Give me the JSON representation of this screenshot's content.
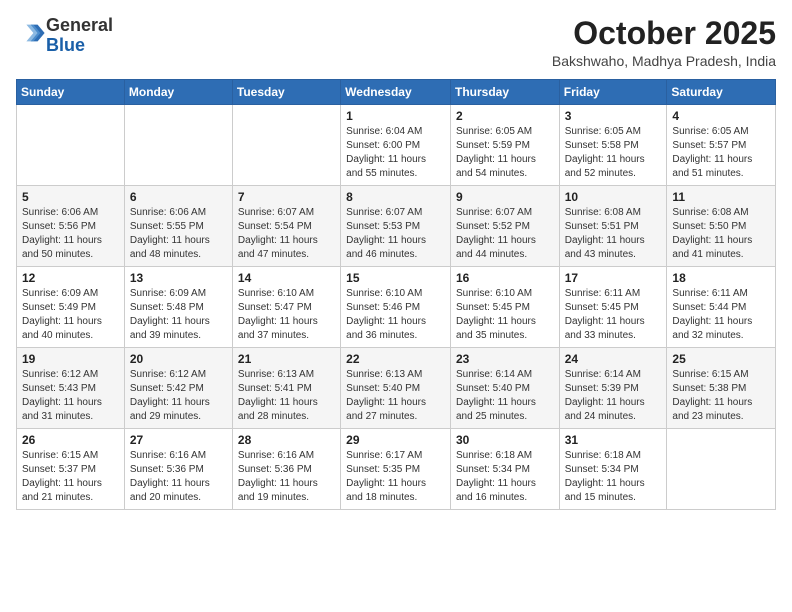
{
  "header": {
    "logo_general": "General",
    "logo_blue": "Blue",
    "month_title": "October 2025",
    "location": "Bakshwaho, Madhya Pradesh, India"
  },
  "days_of_week": [
    "Sunday",
    "Monday",
    "Tuesday",
    "Wednesday",
    "Thursday",
    "Friday",
    "Saturday"
  ],
  "weeks": [
    [
      {
        "day": "",
        "info": ""
      },
      {
        "day": "",
        "info": ""
      },
      {
        "day": "",
        "info": ""
      },
      {
        "day": "1",
        "info": "Sunrise: 6:04 AM\nSunset: 6:00 PM\nDaylight: 11 hours\nand 55 minutes."
      },
      {
        "day": "2",
        "info": "Sunrise: 6:05 AM\nSunset: 5:59 PM\nDaylight: 11 hours\nand 54 minutes."
      },
      {
        "day": "3",
        "info": "Sunrise: 6:05 AM\nSunset: 5:58 PM\nDaylight: 11 hours\nand 52 minutes."
      },
      {
        "day": "4",
        "info": "Sunrise: 6:05 AM\nSunset: 5:57 PM\nDaylight: 11 hours\nand 51 minutes."
      }
    ],
    [
      {
        "day": "5",
        "info": "Sunrise: 6:06 AM\nSunset: 5:56 PM\nDaylight: 11 hours\nand 50 minutes."
      },
      {
        "day": "6",
        "info": "Sunrise: 6:06 AM\nSunset: 5:55 PM\nDaylight: 11 hours\nand 48 minutes."
      },
      {
        "day": "7",
        "info": "Sunrise: 6:07 AM\nSunset: 5:54 PM\nDaylight: 11 hours\nand 47 minutes."
      },
      {
        "day": "8",
        "info": "Sunrise: 6:07 AM\nSunset: 5:53 PM\nDaylight: 11 hours\nand 46 minutes."
      },
      {
        "day": "9",
        "info": "Sunrise: 6:07 AM\nSunset: 5:52 PM\nDaylight: 11 hours\nand 44 minutes."
      },
      {
        "day": "10",
        "info": "Sunrise: 6:08 AM\nSunset: 5:51 PM\nDaylight: 11 hours\nand 43 minutes."
      },
      {
        "day": "11",
        "info": "Sunrise: 6:08 AM\nSunset: 5:50 PM\nDaylight: 11 hours\nand 41 minutes."
      }
    ],
    [
      {
        "day": "12",
        "info": "Sunrise: 6:09 AM\nSunset: 5:49 PM\nDaylight: 11 hours\nand 40 minutes."
      },
      {
        "day": "13",
        "info": "Sunrise: 6:09 AM\nSunset: 5:48 PM\nDaylight: 11 hours\nand 39 minutes."
      },
      {
        "day": "14",
        "info": "Sunrise: 6:10 AM\nSunset: 5:47 PM\nDaylight: 11 hours\nand 37 minutes."
      },
      {
        "day": "15",
        "info": "Sunrise: 6:10 AM\nSunset: 5:46 PM\nDaylight: 11 hours\nand 36 minutes."
      },
      {
        "day": "16",
        "info": "Sunrise: 6:10 AM\nSunset: 5:45 PM\nDaylight: 11 hours\nand 35 minutes."
      },
      {
        "day": "17",
        "info": "Sunrise: 6:11 AM\nSunset: 5:45 PM\nDaylight: 11 hours\nand 33 minutes."
      },
      {
        "day": "18",
        "info": "Sunrise: 6:11 AM\nSunset: 5:44 PM\nDaylight: 11 hours\nand 32 minutes."
      }
    ],
    [
      {
        "day": "19",
        "info": "Sunrise: 6:12 AM\nSunset: 5:43 PM\nDaylight: 11 hours\nand 31 minutes."
      },
      {
        "day": "20",
        "info": "Sunrise: 6:12 AM\nSunset: 5:42 PM\nDaylight: 11 hours\nand 29 minutes."
      },
      {
        "day": "21",
        "info": "Sunrise: 6:13 AM\nSunset: 5:41 PM\nDaylight: 11 hours\nand 28 minutes."
      },
      {
        "day": "22",
        "info": "Sunrise: 6:13 AM\nSunset: 5:40 PM\nDaylight: 11 hours\nand 27 minutes."
      },
      {
        "day": "23",
        "info": "Sunrise: 6:14 AM\nSunset: 5:40 PM\nDaylight: 11 hours\nand 25 minutes."
      },
      {
        "day": "24",
        "info": "Sunrise: 6:14 AM\nSunset: 5:39 PM\nDaylight: 11 hours\nand 24 minutes."
      },
      {
        "day": "25",
        "info": "Sunrise: 6:15 AM\nSunset: 5:38 PM\nDaylight: 11 hours\nand 23 minutes."
      }
    ],
    [
      {
        "day": "26",
        "info": "Sunrise: 6:15 AM\nSunset: 5:37 PM\nDaylight: 11 hours\nand 21 minutes."
      },
      {
        "day": "27",
        "info": "Sunrise: 6:16 AM\nSunset: 5:36 PM\nDaylight: 11 hours\nand 20 minutes."
      },
      {
        "day": "28",
        "info": "Sunrise: 6:16 AM\nSunset: 5:36 PM\nDaylight: 11 hours\nand 19 minutes."
      },
      {
        "day": "29",
        "info": "Sunrise: 6:17 AM\nSunset: 5:35 PM\nDaylight: 11 hours\nand 18 minutes."
      },
      {
        "day": "30",
        "info": "Sunrise: 6:18 AM\nSunset: 5:34 PM\nDaylight: 11 hours\nand 16 minutes."
      },
      {
        "day": "31",
        "info": "Sunrise: 6:18 AM\nSunset: 5:34 PM\nDaylight: 11 hours\nand 15 minutes."
      },
      {
        "day": "",
        "info": ""
      }
    ]
  ]
}
